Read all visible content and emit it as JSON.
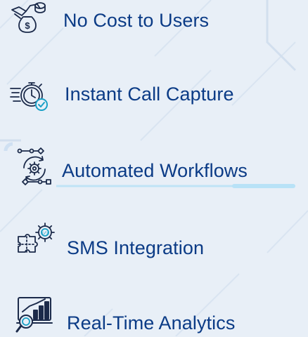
{
  "colors": {
    "background": "#e8eff7",
    "text": "#0b3b86",
    "icon_stroke": "#1b2a4a",
    "icon_accent": "#1aa0c6",
    "glow": "#2fb0ea"
  },
  "features": [
    {
      "label": "No Cost to Users",
      "icon": "money-off-icon"
    },
    {
      "label": "Instant Call Capture",
      "icon": "stopwatch-check-icon"
    },
    {
      "label": "Automated Workflows",
      "icon": "workflow-gear-icon"
    },
    {
      "label": "SMS Integration",
      "icon": "puzzle-gear-icon"
    },
    {
      "label": "Real-Time Analytics",
      "icon": "analytics-chart-icon"
    }
  ]
}
